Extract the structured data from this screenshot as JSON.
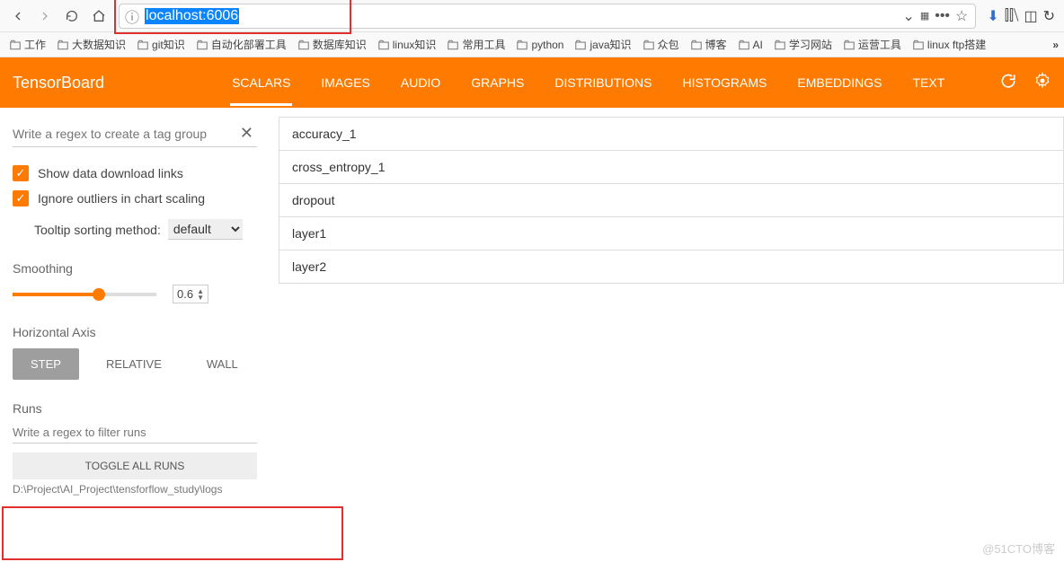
{
  "browser": {
    "url": "localhost:6006",
    "bookmarks": [
      "工作",
      "大数据知识",
      "git知识",
      "自动化部署工具",
      "数据库知识",
      "linux知识",
      "常用工具",
      "python",
      "java知识",
      "众包",
      "博客",
      "AI",
      "学习网站",
      "运营工具",
      "linux ftp搭建"
    ]
  },
  "header": {
    "title": "TensorBoard",
    "tabs": [
      "SCALARS",
      "IMAGES",
      "AUDIO",
      "GRAPHS",
      "DISTRIBUTIONS",
      "HISTOGRAMS",
      "EMBEDDINGS",
      "TEXT"
    ],
    "active_tab": "SCALARS"
  },
  "sidebar": {
    "tag_search_placeholder": "Write a regex to create a tag group",
    "opt_download": "Show data download links",
    "opt_outliers": "Ignore outliers in chart scaling",
    "tooltip_label": "Tooltip sorting method:",
    "tooltip_value": "default",
    "smoothing_label": "Smoothing",
    "smoothing_value": "0.6",
    "axis_label": "Horizontal Axis",
    "axis_step": "STEP",
    "axis_relative": "RELATIVE",
    "axis_wall": "WALL",
    "runs_label": "Runs",
    "runs_search_placeholder": "Write a regex to filter runs",
    "toggle_runs": "TOGGLE ALL RUNS",
    "log_path": "D:\\Project\\AI_Project\\tensforflow_study\\logs"
  },
  "tags": [
    "accuracy_1",
    "cross_entropy_1",
    "dropout",
    "layer1",
    "layer2"
  ],
  "watermark": "@51CTO博客"
}
